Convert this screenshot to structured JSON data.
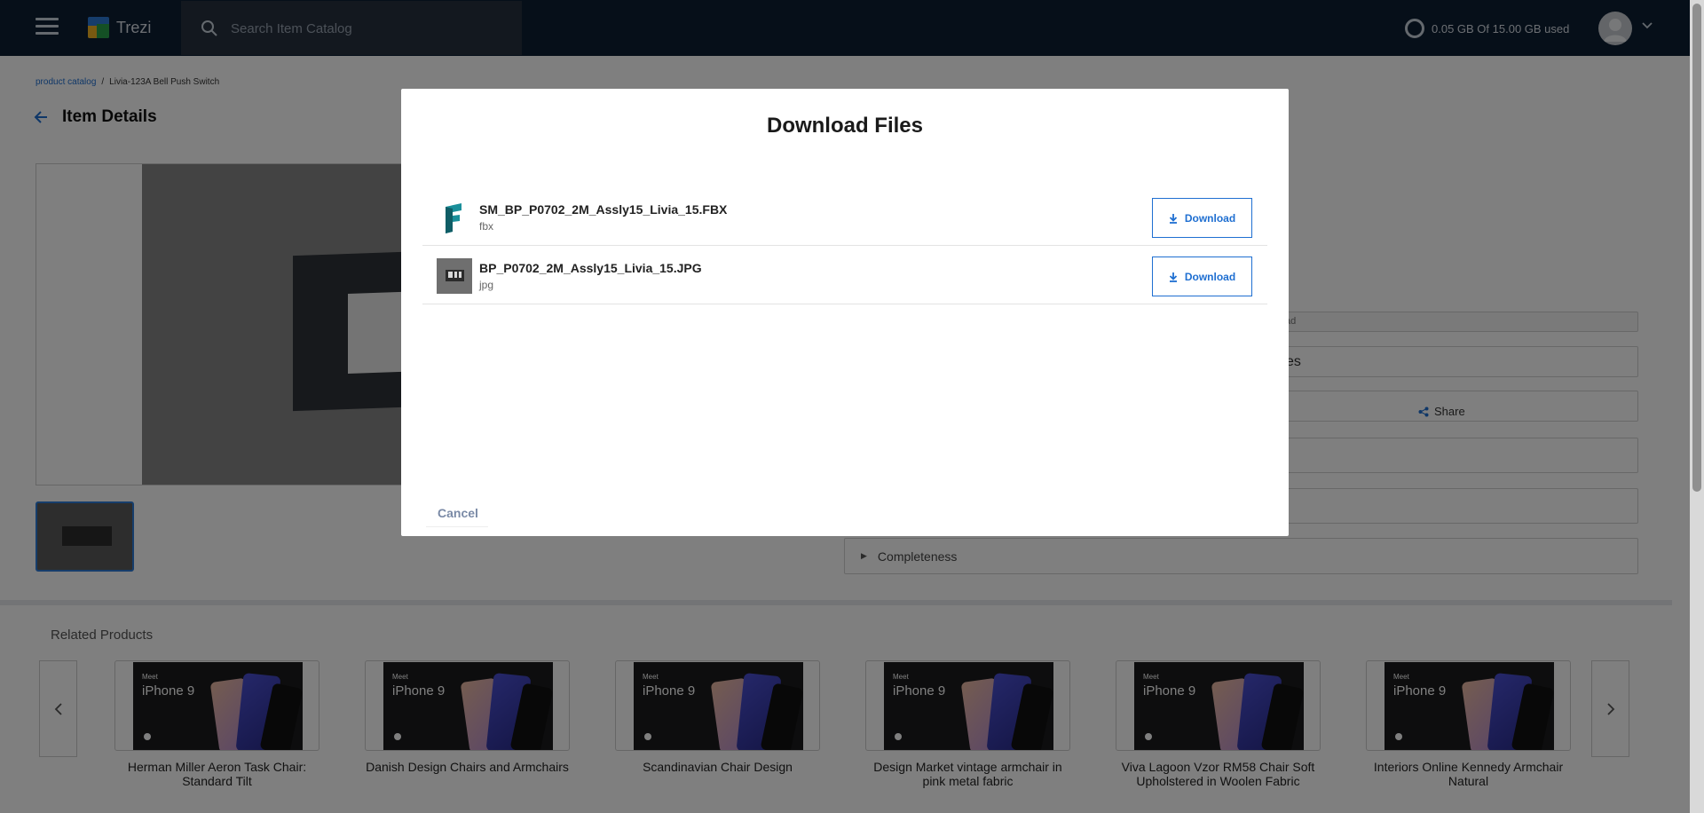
{
  "app": {
    "name": "Trezi"
  },
  "search": {
    "placeholder": "Search Item Catalog"
  },
  "storage": {
    "text": "0.05 GB Of 15.00 GB used"
  },
  "breadcrumb": {
    "root": "product catalog",
    "separator": "/",
    "current": "Livia-123A Bell Push Switch"
  },
  "item": {
    "title": "Item Details"
  },
  "right_panel": {
    "partial_ad": "ad",
    "partial_es": "es",
    "share_label": "Share",
    "completeness_label": "Completeness"
  },
  "related": {
    "title": "Related Products",
    "thumb_meet": "Meet",
    "thumb_name": "iPhone 9",
    "products": [
      {
        "name": "Herman Miller Aeron Task Chair: Standard Tilt"
      },
      {
        "name": "Danish Design Chairs and Armchairs"
      },
      {
        "name": "Scandinavian Chair Design"
      },
      {
        "name": "Design Market vintage armchair in pink metal fabric"
      },
      {
        "name": "Viva Lagoon Vzor RM58 Chair Soft Upholstered in Woolen Fabric"
      },
      {
        "name": "Interiors Online Kennedy Armchair Natural"
      }
    ]
  },
  "modal": {
    "title": "Download Files",
    "files": [
      {
        "name": "SM_BP_P0702_2M_Assly15_Livia_15.FBX",
        "type": "fbx",
        "icon": "fbx-file-icon"
      },
      {
        "name": "BP_P0702_2M_Assly15_Livia_15.JPG",
        "type": "jpg",
        "icon": "jpg-thumbnail-icon"
      }
    ],
    "download_label": "Download",
    "cancel_label": "Cancel"
  },
  "colors": {
    "topbar": "#0c1e33",
    "accent": "#1f6fd1",
    "fbx_teal": "#1a8f9a"
  }
}
